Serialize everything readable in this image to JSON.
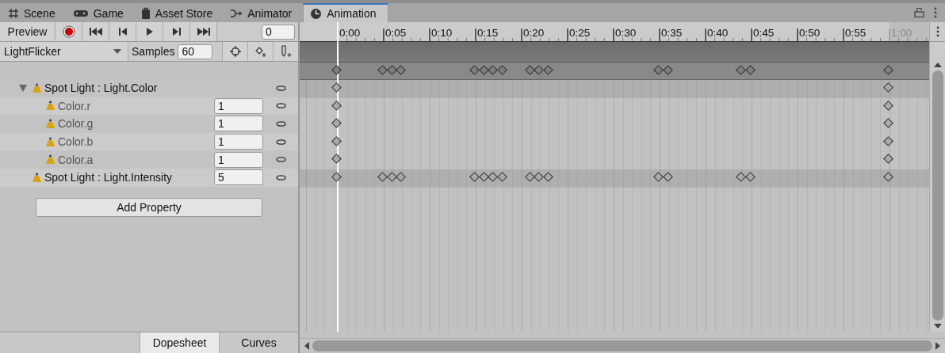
{
  "tabs": [
    {
      "label": "Scene",
      "kind": "scene",
      "selected": false
    },
    {
      "label": "Game",
      "kind": "game",
      "selected": false
    },
    {
      "label": "Asset Store",
      "kind": "store",
      "selected": false
    },
    {
      "label": "Animator",
      "kind": "animator",
      "selected": false
    },
    {
      "label": "Animation",
      "kind": "animation",
      "selected": true
    }
  ],
  "toolbar": {
    "preview_label": "Preview",
    "frame": "0",
    "clip": "LightFlicker",
    "samples_label": "Samples",
    "samples": "60"
  },
  "ruler": [
    {
      "label": "0:00",
      "past_end": false
    },
    {
      "label": "0:05",
      "past_end": false
    },
    {
      "label": "0:10",
      "past_end": false
    },
    {
      "label": "0:15",
      "past_end": false
    },
    {
      "label": "0:20",
      "past_end": false
    },
    {
      "label": "0:25",
      "past_end": false
    },
    {
      "label": "0:30",
      "past_end": false
    },
    {
      "label": "0:35",
      "past_end": false
    },
    {
      "label": "0:40",
      "past_end": false
    },
    {
      "label": "0:45",
      "past_end": false
    },
    {
      "label": "0:50",
      "past_end": false
    },
    {
      "label": "0:55",
      "past_end": false
    },
    {
      "label": "1:00",
      "past_end": true
    }
  ],
  "tracks": [
    {
      "label": "Spot Light : Light.Color",
      "kind": "group",
      "expanded": true,
      "children": [
        {
          "label": "Color.r",
          "value": "1"
        },
        {
          "label": "Color.g",
          "value": "1"
        },
        {
          "label": "Color.b",
          "value": "1"
        },
        {
          "label": "Color.a",
          "value": "1"
        }
      ]
    },
    {
      "label": "Spot Light : Light.Intensity",
      "kind": "single",
      "value": "5"
    }
  ],
  "add_property": "Add Property",
  "view_tabs": [
    {
      "label": "Dopesheet",
      "selected": true
    },
    {
      "label": "Curves",
      "selected": false
    }
  ]
}
